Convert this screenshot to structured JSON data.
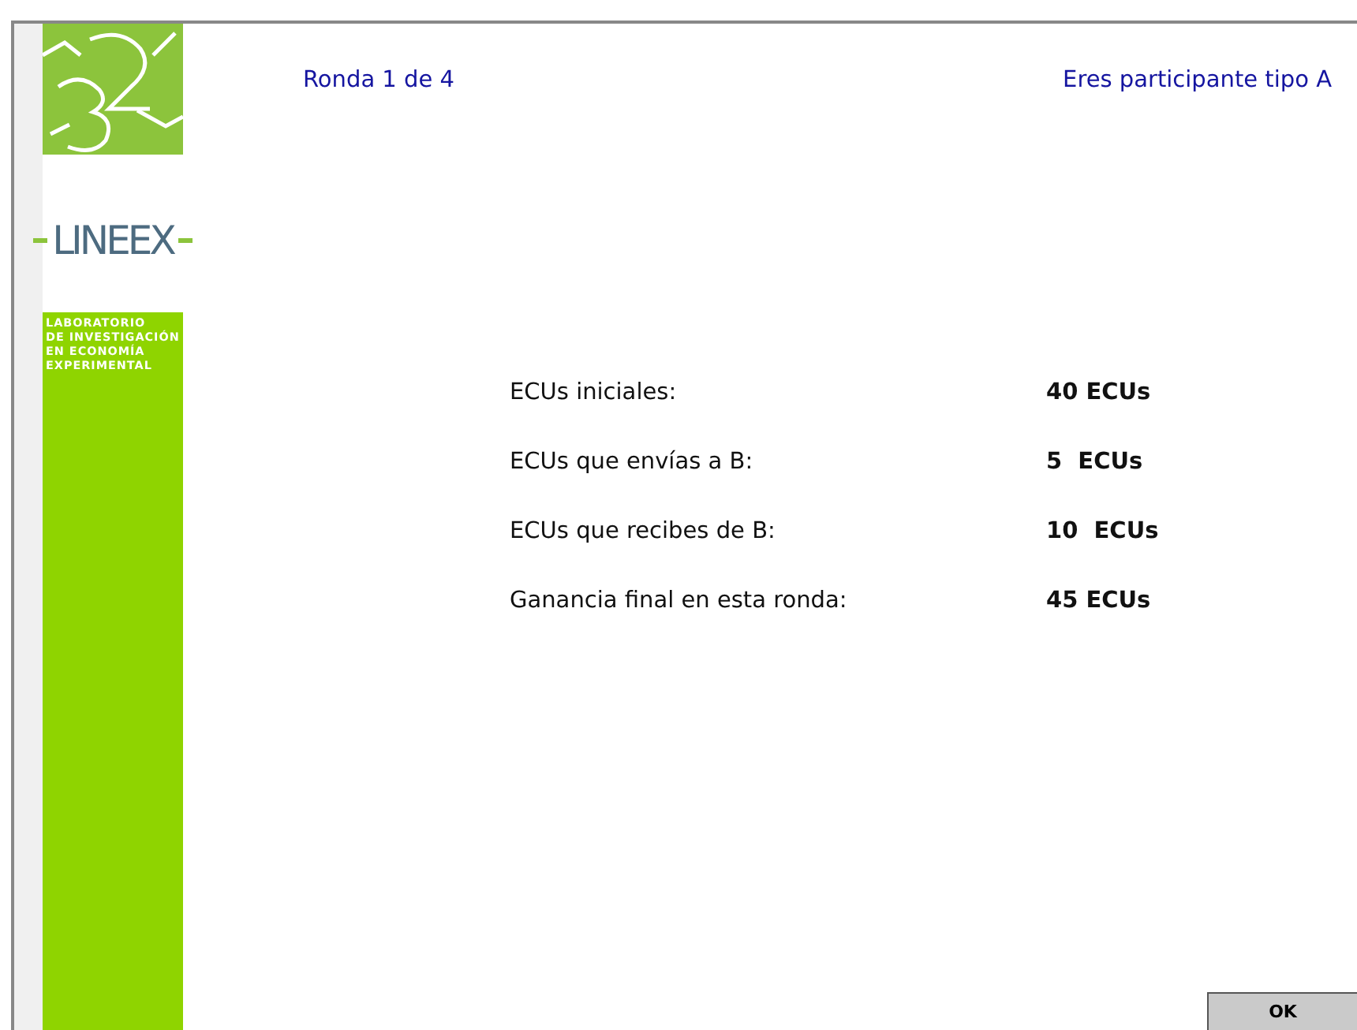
{
  "header": {
    "round": "Ronda 1 de 4",
    "role": "Eres participante tipo A"
  },
  "logo": {
    "name": "LINEEX",
    "tagline": [
      "LABORATORIO",
      "DE INVESTIGACIÓN",
      "EN ECONOMÍA",
      "EXPERIMENTAL"
    ]
  },
  "results": [
    {
      "label": "ECUs iniciales:",
      "value": "40 ECUs"
    },
    {
      "label": "ECUs que envías a B:",
      "value": "5  ECUs"
    },
    {
      "label": "ECUs que recibes de B:",
      "value": "10  ECUs"
    },
    {
      "label": "Ganancia final en esta ronda:",
      "value": "45 ECUs"
    }
  ],
  "buttons": [
    "OK"
  ]
}
